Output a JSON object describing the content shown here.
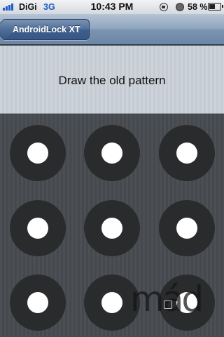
{
  "status_bar": {
    "carrier": "DiGi",
    "network": "3G",
    "time": "10:43 PM",
    "battery_percent": "58 %",
    "battery_level": 0.58,
    "icons": [
      "signal-icon",
      "rotation-lock-icon",
      "alarm-icon",
      "battery-icon"
    ]
  },
  "nav_bar": {
    "back_label": "AndroidLock XT"
  },
  "instruction": {
    "text": "Draw the old pattern"
  },
  "pattern": {
    "rows": 3,
    "columns": 3,
    "dots": [
      1,
      2,
      3,
      4,
      5,
      6,
      7,
      8,
      9
    ]
  },
  "watermark": {
    "logo": "mád"
  },
  "colors": {
    "accent": "#1f5fc4",
    "nav_bar": "#7b94b1",
    "dot_ring": "#2a2b2d",
    "dot_center": "#ffffff"
  }
}
